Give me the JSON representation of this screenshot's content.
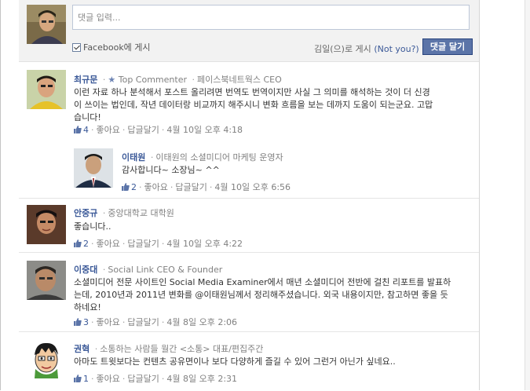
{
  "composer": {
    "placeholder": "댓글 입력...",
    "post_to_label": "Facebook에 게시",
    "posting_as": "김일(으)로 게시",
    "not_you": "(Not you?)",
    "submit_label": "댓글 달기"
  },
  "comments": [
    {
      "author": "최규문",
      "badge": "Top Commenter",
      "title": "페이스북네트웍스 CEO",
      "text_lines": [
        "이런 자료 하나 분석해서 포스트 올리려면 번역도 번역이지만 사실 그 의미를 해석하는 것이 더 신경",
        "이 쓰이는 법인데, 작년 데이터랑 비교까지 해주시니 변화 흐름을 보는 데까지 도움이 되는군요. 고맙",
        "습니다!"
      ],
      "likes": "4",
      "like_label": "좋아요",
      "reply_label": "답글달기",
      "time": "4월 10일 오후 4:18"
    },
    {
      "author": "이태원",
      "title": "이태원의 소셜미디어 마케팅 운영자",
      "text_lines": [
        "감사합니다~ 소장님~ ^^"
      ],
      "likes": "2",
      "like_label": "좋아요",
      "reply_label": "답글달기",
      "time": "4월 10일 오후 6:56"
    },
    {
      "author": "안중규",
      "title": "중앙대학교 대학원",
      "text_lines": [
        "좋습니다.."
      ],
      "likes": "2",
      "like_label": "좋아요",
      "reply_label": "답글달기",
      "time": "4월 10일 오후 4:22"
    },
    {
      "author": "이중대",
      "title": "Social Link CEO & Founder",
      "text_lines": [
        "소셜미디어 전문 사이트인 Social Media Examiner에서 매년 소셜미디어 전반에 걸친 리포트를 발표하",
        "는데, 2010년과 2011년 변화를 @이태원님께서 정리해주셨습니다. 외국 내용이지만, 참고하면 좋을 듯",
        "하네요!"
      ],
      "likes": "3",
      "like_label": "좋아요",
      "reply_label": "답글달기",
      "time": "4월 8일 오후 2:06"
    },
    {
      "author": "권혁",
      "title": "소통하는 사람들 월간 <소통> 대표/편집주간",
      "text_lines": [
        "아마도 트윗보다는 컨텐츠 공유면이나 보다 다양하게 즐길 수 있어 그런거 아닌가 싶네요.."
      ],
      "likes": "1",
      "like_label": "좋아요",
      "reply_label": "답글달기",
      "time": "4월 8일 오후 2:31"
    }
  ],
  "colors": {
    "link_blue": "#3b5998",
    "button_blue": "#5b74a8",
    "meta_gray": "#808080"
  }
}
